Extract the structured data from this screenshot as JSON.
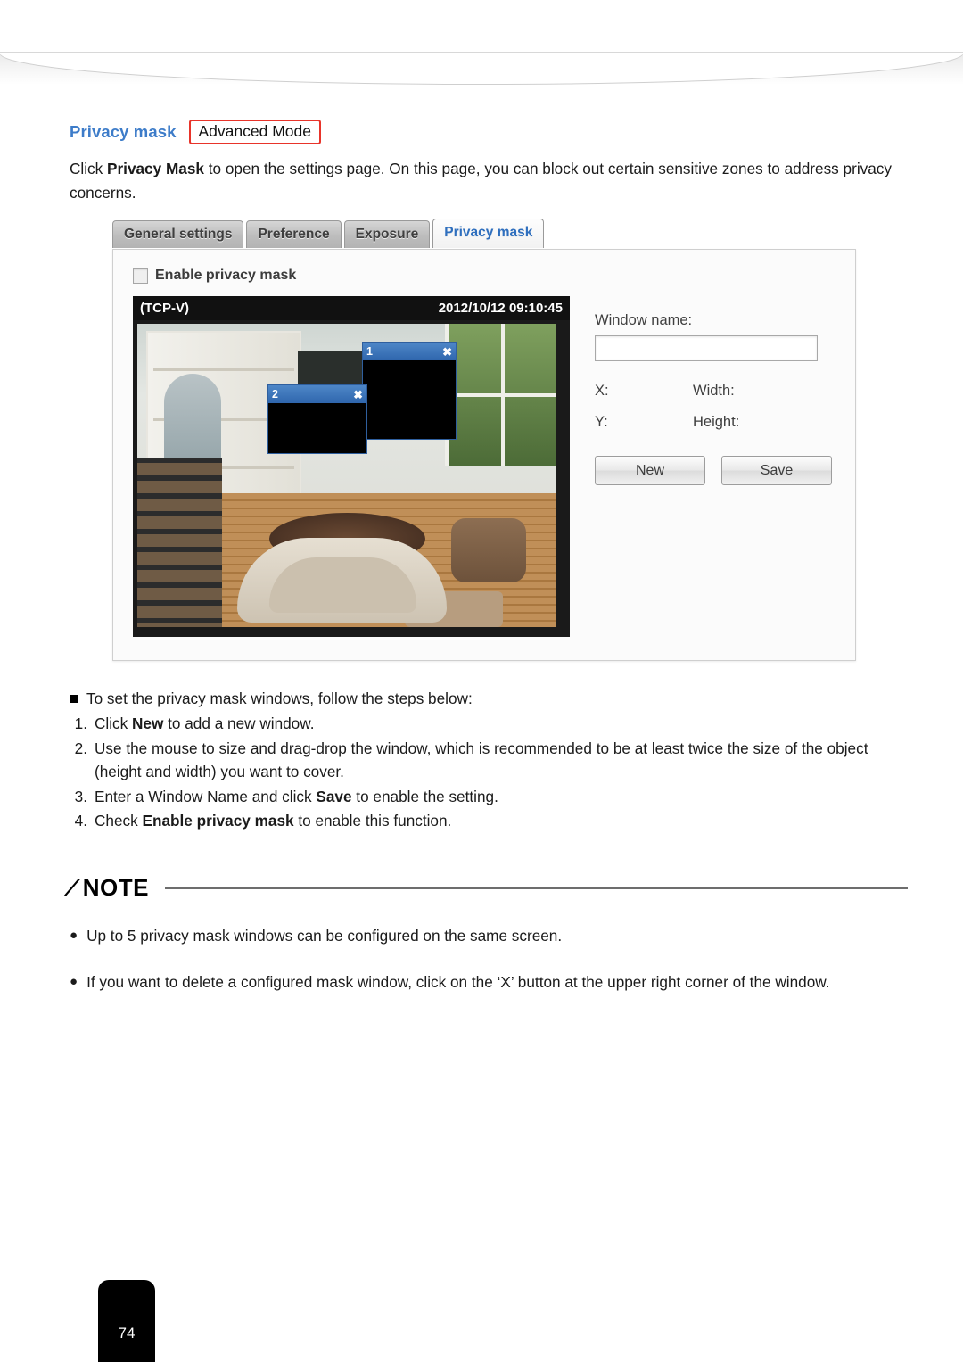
{
  "page": {
    "number": "74"
  },
  "heading": {
    "title": "Privacy mask",
    "mode_badge": "Advanced Mode"
  },
  "intro": {
    "line1_pre": "Click ",
    "line1_bold": "Privacy Mask",
    "line1_post": " to open the settings page. On this page, you can block out certain sensitive zones to address privacy concerns."
  },
  "ui": {
    "tabs": [
      {
        "label": "General settings",
        "active": false
      },
      {
        "label": "Preference",
        "active": false
      },
      {
        "label": "Exposure",
        "active": false
      },
      {
        "label": "Privacy mask",
        "active": true
      }
    ],
    "checkbox": {
      "label": "Enable privacy mask",
      "checked": false
    },
    "video": {
      "protocol": "(TCP-V)",
      "timestamp": "2012/10/12 09:10:45"
    },
    "mask_windows": [
      {
        "number": "1",
        "close": "✖"
      },
      {
        "number": "2",
        "close": "✖"
      }
    ],
    "form": {
      "window_name_label": "Window name:",
      "window_name_value": "",
      "x_label": "X:",
      "y_label": "Y:",
      "width_label": "Width:",
      "height_label": "Height:",
      "new_button": "New",
      "save_button": "Save"
    }
  },
  "steps": {
    "intro": "To set the privacy mask windows, follow the steps below:",
    "items": [
      {
        "no": "1.",
        "pre": "Click ",
        "bold": "New",
        "post": " to add a new window."
      },
      {
        "no": "2.",
        "pre": "Use the mouse to size and drag-drop the window, which is recommended to be at least twice the size of the object (height and width) you want to cover.",
        "bold": "",
        "post": ""
      },
      {
        "no": "3.",
        "pre": "Enter a Window Name and click ",
        "bold": "Save",
        "post": " to enable the setting."
      },
      {
        "no": "4.",
        "pre": "Check ",
        "bold": "Enable privacy mask",
        "post": " to enable this function."
      }
    ]
  },
  "note": {
    "title": "NOTE",
    "items": [
      "Up to 5 privacy mask windows can be configured on the same screen.",
      "If you want to delete a configured mask window, click on the ‘X’ button at the upper right corner of the window."
    ]
  }
}
